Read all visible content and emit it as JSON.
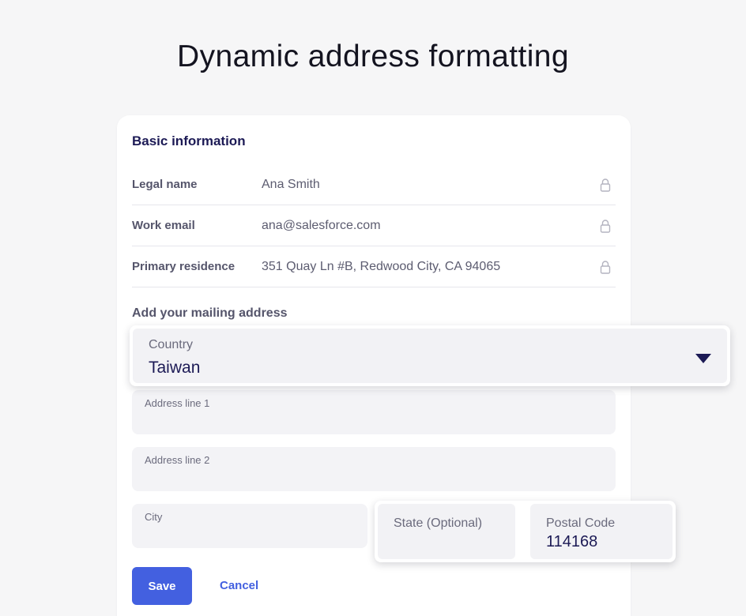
{
  "hero": {
    "title": "Dynamic address formatting"
  },
  "basic_info": {
    "title": "Basic information",
    "rows": [
      {
        "label": "Legal name",
        "value": "Ana Smith",
        "icon": "lock-icon"
      },
      {
        "label": "Work email",
        "value": "ana@salesforce.com",
        "icon": "lock-icon"
      },
      {
        "label": "Primary residence",
        "value": "351 Quay Ln #B, Redwood City, CA 94065",
        "icon": "lock-icon"
      }
    ]
  },
  "mailing": {
    "title": "Add your mailing address",
    "country": {
      "label": "Country",
      "value": "Taiwan",
      "icon": "caret-down-icon"
    },
    "address_line_1": {
      "label": "Address line 1",
      "value": ""
    },
    "address_line_2": {
      "label": "Address line 2",
      "value": ""
    },
    "city": {
      "label": "City",
      "value": ""
    },
    "state": {
      "label": "State (Optional)",
      "value": ""
    },
    "postal_code": {
      "label": "Postal Code",
      "value": "114168"
    }
  },
  "actions": {
    "save_label": "Save",
    "cancel_label": "Cancel"
  },
  "colors": {
    "accent": "#4360e0",
    "heading": "#1c1a55",
    "background": "#f6f6f7"
  }
}
